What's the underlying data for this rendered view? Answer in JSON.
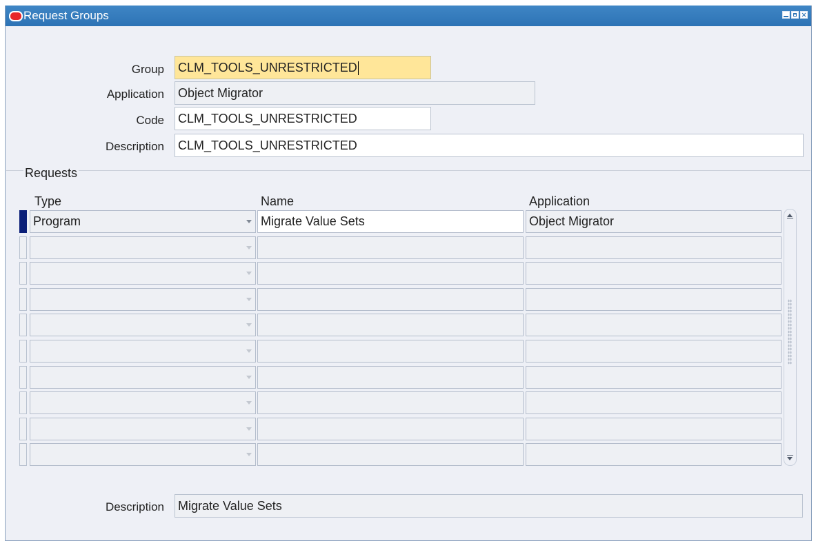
{
  "window": {
    "title": "Request Groups"
  },
  "form": {
    "group": {
      "label": "Group",
      "value": "CLM_TOOLS_UNRESTRICTED"
    },
    "application": {
      "label": "Application",
      "value": "Object Migrator"
    },
    "code": {
      "label": "Code",
      "value": "CLM_TOOLS_UNRESTRICTED"
    },
    "description": {
      "label": "Description",
      "value": "CLM_TOOLS_UNRESTRICTED"
    }
  },
  "requests": {
    "title": "Requests",
    "columns": {
      "type": "Type",
      "name": "Name",
      "application": "Application"
    },
    "rows": [
      {
        "type": "Program",
        "name": "Migrate Value Sets",
        "application": "Object Migrator"
      },
      {
        "type": "",
        "name": "",
        "application": ""
      },
      {
        "type": "",
        "name": "",
        "application": ""
      },
      {
        "type": "",
        "name": "",
        "application": ""
      },
      {
        "type": "",
        "name": "",
        "application": ""
      },
      {
        "type": "",
        "name": "",
        "application": ""
      },
      {
        "type": "",
        "name": "",
        "application": ""
      },
      {
        "type": "",
        "name": "",
        "application": ""
      },
      {
        "type": "",
        "name": "",
        "application": ""
      },
      {
        "type": "",
        "name": "",
        "application": ""
      }
    ]
  },
  "footer": {
    "description_label": "Description",
    "description_value": "Migrate Value Sets"
  },
  "colors": {
    "titlebar": "#2d73b5",
    "active_field": "#ffe699",
    "row_indicator": "#0b1f78"
  }
}
